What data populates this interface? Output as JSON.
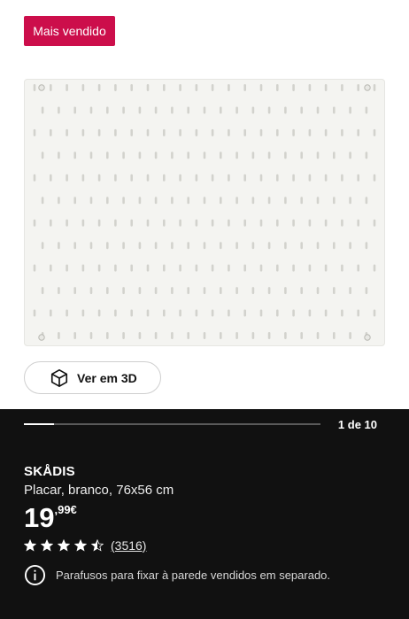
{
  "badge": {
    "label": "Mais vendido",
    "color": "#cc0e4b"
  },
  "view3d": {
    "label": "Ver em 3D",
    "icon": "cube-icon"
  },
  "gallery": {
    "counter": "1 de 10",
    "progress": 0.1
  },
  "product": {
    "name": "SKÅDIS",
    "description": "Placar, branco, 76x56 cm",
    "price_integer": "19",
    "price_decimal": ",99€",
    "rating_value": 4.5,
    "rating_count": "(3516)",
    "note": "Parafusos para fixar à parede vendidos em separado.",
    "note_icon": "info-icon"
  },
  "colors": {
    "dark_background": "#111111",
    "board": "#f4f4f1"
  }
}
